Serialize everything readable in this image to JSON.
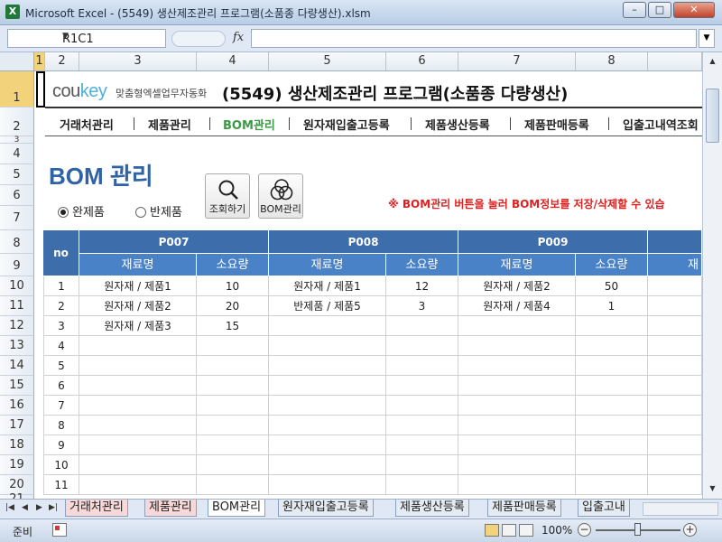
{
  "window": {
    "title": "Microsoft Excel - (5549) 생산제조관리 프로그램(소품종 다량생산).xlsm",
    "app_icon": "X",
    "minimize": "–",
    "restore": "□",
    "close": "✕"
  },
  "formula_bar": {
    "name_box": "R1C1",
    "fx": "fx",
    "value": ""
  },
  "columns": [
    "1",
    "2",
    "3",
    "4",
    "5",
    "6",
    "7",
    "8"
  ],
  "rows": [
    "1",
    "2",
    "3",
    "4",
    "5",
    "6",
    "7",
    "8",
    "9",
    "10",
    "11",
    "12",
    "13",
    "14",
    "15",
    "16",
    "17",
    "18",
    "19",
    "20",
    "21"
  ],
  "header": {
    "logo_main": "cou",
    "logo_accent": "key",
    "logo_sub": "맞춤형엑셀업무자동화",
    "program_title": "(5549) 생산제조관리 프로그램(소품종 다량생산)"
  },
  "menu": [
    "거래처관리",
    "제품관리",
    "BOM관리",
    "원자재입출고등록",
    "제품생산등록",
    "제품판매등록",
    "입출고내역조회"
  ],
  "page": {
    "title": "BOM 관리",
    "radio_finished": "완제품",
    "radio_semi": "반제품",
    "search_button": "조회하기",
    "bom_button": "BOM관리",
    "notice": "※ BOM관리 버튼을 눌러 BOM정보를 저장/삭제할 수 있습"
  },
  "grid": {
    "no_header": "no",
    "products": [
      "P007",
      "P008",
      "P009"
    ],
    "material_header": "재료명",
    "qty_header": "소요량",
    "extra_header": "재",
    "rows": [
      {
        "no": "1",
        "c": [
          "원자재 / 제품1",
          "10",
          "원자재 / 제품1",
          "12",
          "원자재 / 제품2",
          "50"
        ]
      },
      {
        "no": "2",
        "c": [
          "원자재 / 제품2",
          "20",
          "반제품 / 제품5",
          "3",
          "원자재 / 제품4",
          "1"
        ]
      },
      {
        "no": "3",
        "c": [
          "원자재 / 제품3",
          "15",
          "",
          "",
          "",
          ""
        ]
      },
      {
        "no": "4",
        "c": [
          "",
          "",
          "",
          "",
          "",
          ""
        ]
      },
      {
        "no": "5",
        "c": [
          "",
          "",
          "",
          "",
          "",
          ""
        ]
      },
      {
        "no": "6",
        "c": [
          "",
          "",
          "",
          "",
          "",
          ""
        ]
      },
      {
        "no": "7",
        "c": [
          "",
          "",
          "",
          "",
          "",
          ""
        ]
      },
      {
        "no": "8",
        "c": [
          "",
          "",
          "",
          "",
          "",
          ""
        ]
      },
      {
        "no": "9",
        "c": [
          "",
          "",
          "",
          "",
          "",
          ""
        ]
      },
      {
        "no": "10",
        "c": [
          "",
          "",
          "",
          "",
          "",
          ""
        ]
      },
      {
        "no": "11",
        "c": [
          "",
          "",
          "",
          "",
          "",
          ""
        ]
      }
    ]
  },
  "sheet_tabs": [
    "거래처관리",
    "제품관리",
    "BOM관리",
    "원자재입출고등록",
    "제품생산등록",
    "제품판매등록",
    "입출고내"
  ],
  "status": {
    "ready": "준비",
    "zoom": "100%"
  }
}
